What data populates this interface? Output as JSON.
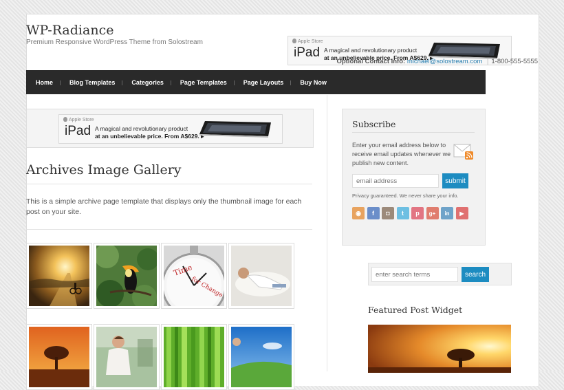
{
  "header": {
    "site_title": "WP-Radiance",
    "site_description": "Premium Responsive WordPress Theme from Solostream",
    "contact": {
      "label": "Optional Contact Info:",
      "email": "michael@solostream.com",
      "separator": "|",
      "phone": "1-800-555-5555"
    }
  },
  "ad_banner": {
    "store_label": "Apple Store",
    "product": "iPad",
    "tagline_line1": "A magical and revolutionary product",
    "tagline_line2": "at an unbelievable price. From A$629.",
    "arrow": "▸"
  },
  "nav": {
    "items": [
      "Home",
      "Blog Templates",
      "Categories",
      "Page Templates",
      "Page Layouts",
      "Buy Now"
    ]
  },
  "main": {
    "title": "Archives Image Gallery",
    "intro": "This is a simple archive page template that displays only the thumbnail image for each post on your site.",
    "gallery": [
      {
        "name": "sunset-cyclist"
      },
      {
        "name": "toucan"
      },
      {
        "name": "time-for-change-clock"
      },
      {
        "name": "relaxing-man"
      },
      {
        "name": "lone-tree-sunset"
      },
      {
        "name": "woman-meditating"
      },
      {
        "name": "green-bamboo"
      },
      {
        "name": "hills-blue-sky"
      }
    ],
    "clock_text_line1": "Time",
    "clock_text_line2": "for Change"
  },
  "sidebar": {
    "subscribe": {
      "title": "Subscribe",
      "text": "Enter your email address below to receive email updates whenever we publish new content.",
      "email_placeholder": "email address",
      "submit_label": "submit",
      "privacy": "Privacy guaranteed. We never share your info.",
      "social_icons": [
        {
          "icon": "rss-icon",
          "glyph": "◉",
          "color": "#e8a35f"
        },
        {
          "icon": "facebook-icon",
          "glyph": "f",
          "color": "#6b8ec9"
        },
        {
          "icon": "instagram-icon",
          "glyph": "◘",
          "color": "#9c8a7a"
        },
        {
          "icon": "twitter-icon",
          "glyph": "t",
          "color": "#6dbfe2"
        },
        {
          "icon": "pinterest-icon",
          "glyph": "p",
          "color": "#e27582"
        },
        {
          "icon": "google-plus-icon",
          "glyph": "g+",
          "color": "#e07d6e"
        },
        {
          "icon": "linkedin-icon",
          "glyph": "in",
          "color": "#6fa3c9"
        },
        {
          "icon": "youtube-icon",
          "glyph": "▶",
          "color": "#e07070"
        }
      ]
    },
    "search": {
      "placeholder": "enter search terms",
      "button_label": "search"
    },
    "featured": {
      "title": "Featured Post Widget"
    }
  },
  "colors": {
    "accent": "#1d8cc1",
    "nav_background": "#2a2a2a",
    "link": "#2a7fb0"
  }
}
